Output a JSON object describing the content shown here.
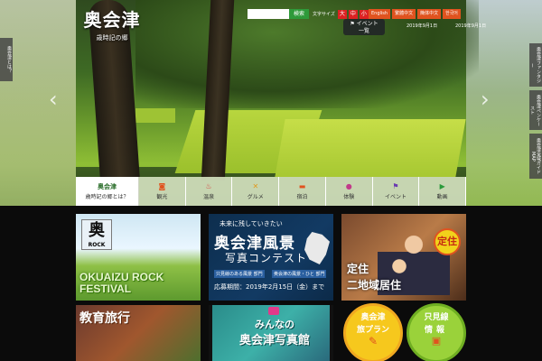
{
  "logo": {
    "title": "奥会津",
    "subtitle": "歳時記の郷"
  },
  "search": {
    "placeholder": "",
    "button": "検索"
  },
  "font_size": {
    "label": "文字サイズ",
    "options": [
      "大",
      "中",
      "小"
    ]
  },
  "languages": [
    "English",
    "繁體中文",
    "簡体中文",
    "한국어"
  ],
  "event_badge": {
    "line1": "イベント",
    "line2": "一覧"
  },
  "dates": [
    "2019年9月1日",
    "2019年9月1日"
  ],
  "side_tabs": {
    "left": "奥会津とは？",
    "right": [
      "奥会津ファンタジー",
      "奥会津ペンケースト",
      "奥会津全域ガイドMAP"
    ]
  },
  "nav": {
    "home_label": "奥会津",
    "home_question": "歳時記の郷とは？",
    "items": [
      {
        "label": "観光",
        "icon": "camera-icon",
        "color": "#e0531f"
      },
      {
        "label": "温泉",
        "icon": "onsen-icon",
        "color": "#d83a3a"
      },
      {
        "label": "グルメ",
        "icon": "food-icon",
        "color": "#e09a1f"
      },
      {
        "label": "宿泊",
        "icon": "bed-icon",
        "color": "#e0531f"
      },
      {
        "label": "体験",
        "icon": "experience-icon",
        "color": "#c23a8a"
      },
      {
        "label": "イベント",
        "icon": "flag-icon",
        "color": "#6a3ab0"
      },
      {
        "label": "動画",
        "icon": "video-icon",
        "color": "#2a9a3a"
      }
    ]
  },
  "tiles": {
    "rock": {
      "logo_kanji": "奥",
      "logo_text": "ROCK",
      "title_l1": "OKUAIZU ROCK",
      "title_l2": "FESTIVAL"
    },
    "contest": {
      "line1": "未来に残していきたい",
      "line2": "奥会津風景",
      "line3": "写真コンテスト",
      "cat1": "只見線のある風景 部門",
      "cat2": "奥会津の風景・ひと 部門",
      "period": "応募期間：2019年2月15日（金）まで"
    },
    "teiju": {
      "badge": "定住",
      "line1": "定住",
      "line2": "二地域居住"
    },
    "edu": {
      "title": "教育旅行"
    },
    "photo": {
      "line1": "みんなの",
      "line2": "奥会津写真館"
    },
    "plan": {
      "line1": "奥会津",
      "line2": "旅プラン"
    },
    "info": {
      "line1": "只見線",
      "line2": "情報"
    }
  }
}
